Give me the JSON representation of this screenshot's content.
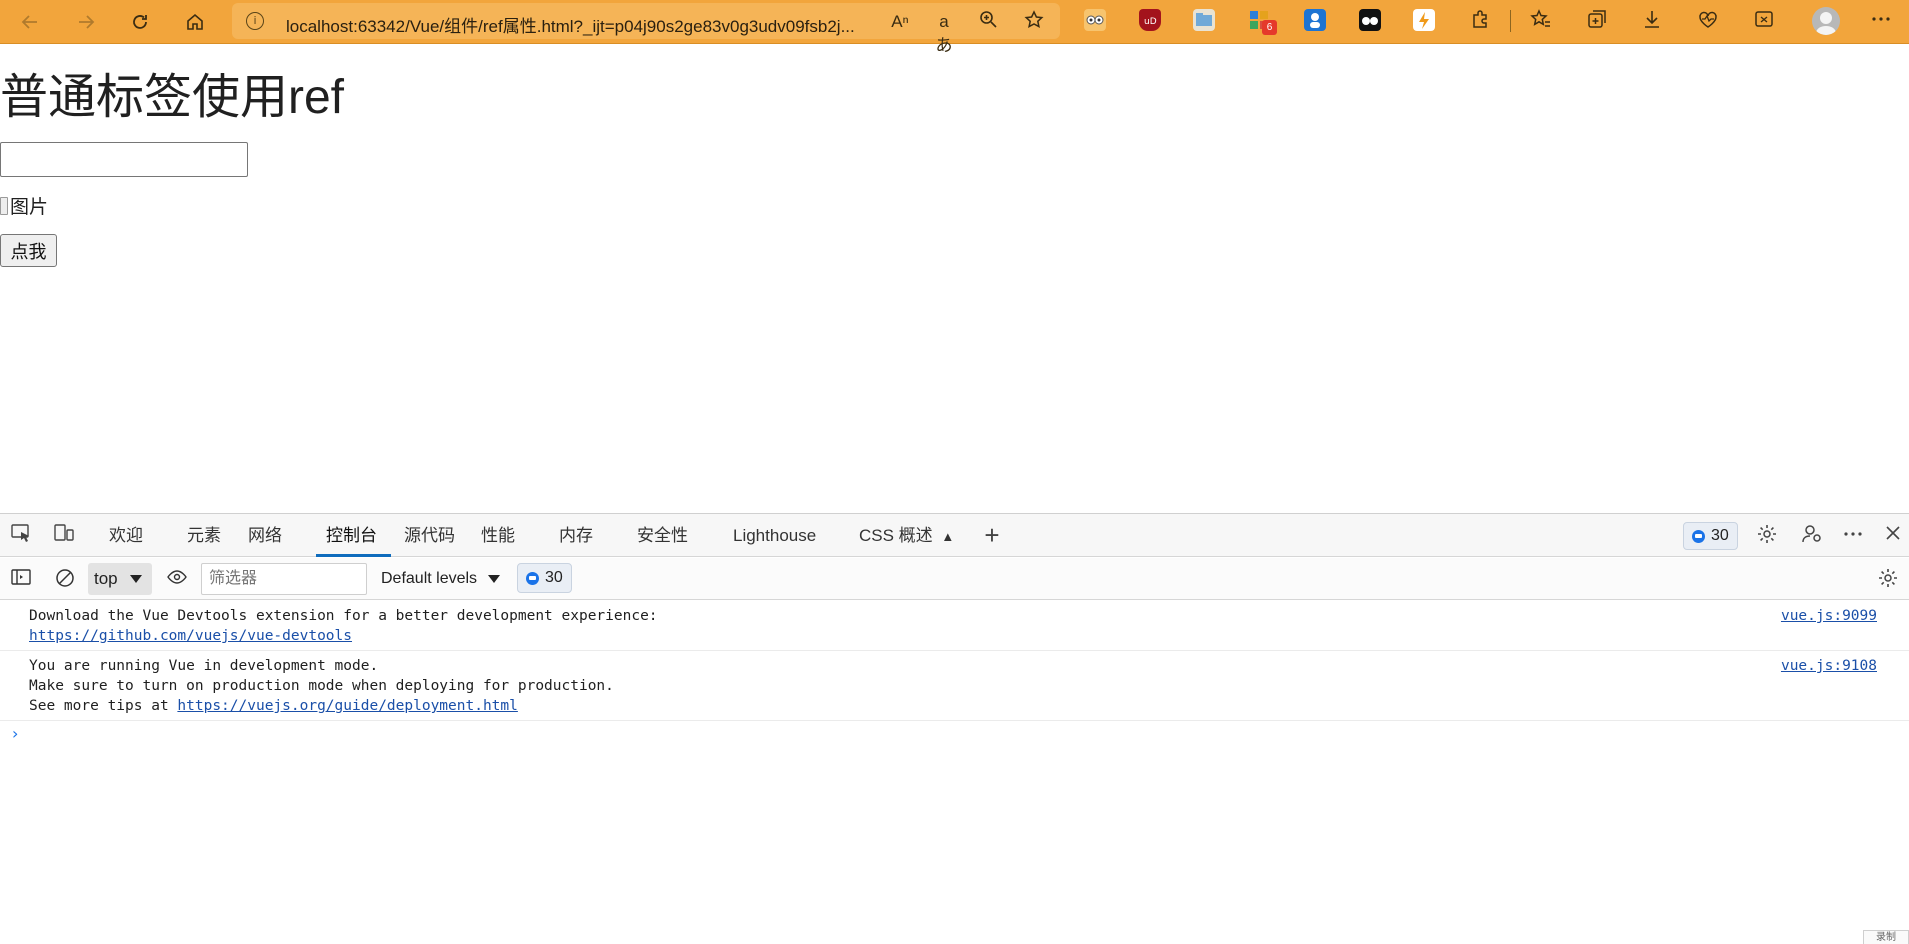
{
  "browser": {
    "url": "localhost:63342/Vue/组件/ref属性.html?_ijt=p04j90s2ge83v0g3udv09fsb2j...",
    "info_icon": "i",
    "extension_badge": "6",
    "accent_color": "#f2a53c"
  },
  "page": {
    "title": "普通标签使用ref",
    "input_value": "",
    "image_alt": "图片",
    "button_label": "点我"
  },
  "devtools": {
    "tabs": [
      "欢迎",
      "元素",
      "网络",
      "控制台",
      "源代码",
      "性能",
      "内存",
      "安全性",
      "Lighthouse",
      "CSS 概述"
    ],
    "active_tab": "控制台",
    "issue_count": "30",
    "context": "top",
    "filter_placeholder": "筛选器",
    "levels": "Default levels",
    "filter_issue_count": "30",
    "messages": [
      {
        "lines": [
          "Download the Vue Devtools extension for a better development experience:"
        ],
        "link": "https://github.com/vuejs/vue-devtools",
        "source": "vue.js:9099"
      },
      {
        "lines": [
          "You are running Vue in development mode.",
          "Make sure to turn on production mode when deploying for production."
        ],
        "prefix": "See more tips at ",
        "link": "https://vuejs.org/guide/deployment.html",
        "source": "vue.js:9108"
      }
    ],
    "prompt": "›",
    "corner_label": "录制"
  }
}
